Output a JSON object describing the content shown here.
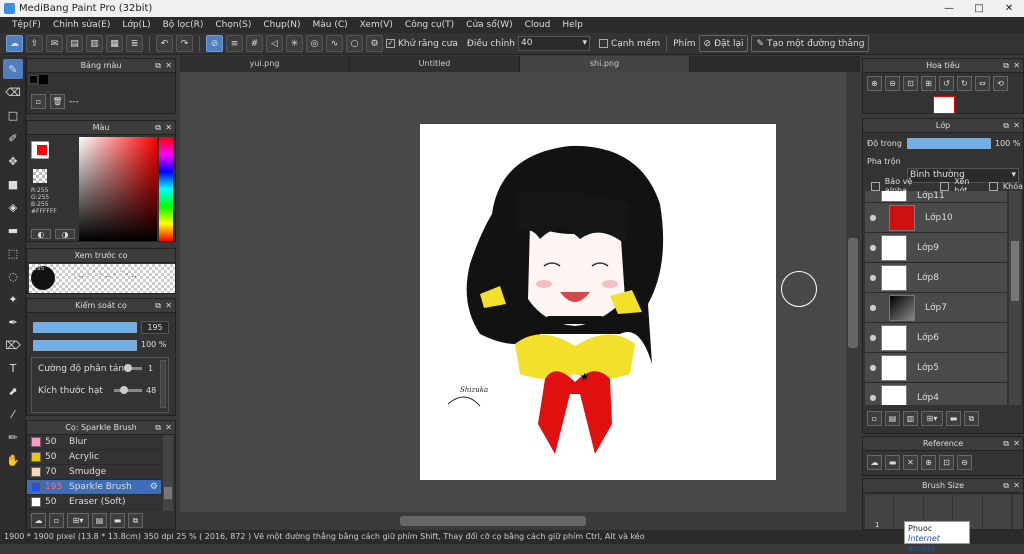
{
  "window": {
    "title": "MediBang Paint Pro (32bit)",
    "minimize": "—",
    "maximize": "□",
    "close": "✕"
  },
  "menu": [
    "Tệp(F)",
    "Chỉnh sửa(E)",
    "Lớp(L)",
    "Bộ lọc(R)",
    "Chọn(S)",
    "Chụp(N)",
    "Màu (C)",
    "Xem(V)",
    "Công cụ(T)",
    "Cửa sổ(W)",
    "Cloud",
    "Help"
  ],
  "toolbar": {
    "antialias_label": "Khử răng cưa",
    "adjust_label": "Điều chỉnh",
    "adjust_value": "40",
    "edge_label": "Cạnh mềm",
    "key_label": "Phím",
    "reset_label": "Đặt lại",
    "line_label": "Tạo một đường thẳng"
  },
  "colors": {
    "accent": "#4f7fc0",
    "primary": "#ff0000",
    "secondary": "#ffffff"
  },
  "palette_panel": {
    "title": "Bảng màu",
    "dash": "---"
  },
  "color_panel": {
    "title": "Màu",
    "r": "R:255",
    "g": "G:255",
    "b": "B:255",
    "hex": "#FFFFFF"
  },
  "brush_preview": {
    "title": "Xem trước cọ",
    "size": "195"
  },
  "brush_control": {
    "title": "Kiểm soát cọ",
    "size_value": "195",
    "opacity_value": "100 %",
    "scatter_label": "Cường độ phân tán",
    "scatter_value": "1",
    "particle_label": "Kích thước hạt",
    "particle_value": "48"
  },
  "brush_list": {
    "title": "Cọ: Sparkle Brush",
    "items": [
      {
        "size": "50",
        "name": "Blur",
        "color": "#ff99cc"
      },
      {
        "size": "50",
        "name": "Acrylic",
        "color": "#e8c800"
      },
      {
        "size": "70",
        "name": "Smudge",
        "color": "#f8d8b8"
      },
      {
        "size": "195",
        "name": "Sparkle Brush",
        "color": "#2255dd"
      },
      {
        "size": "50",
        "name": "Eraser (Soft)",
        "color": "#ffffff"
      }
    ]
  },
  "tabs": [
    "yui.png",
    "Untitled",
    "shi.png"
  ],
  "canvas": {
    "signature": "Shizuka"
  },
  "navigator": {
    "title": "Hoa tiêu"
  },
  "layer_panel": {
    "title": "Lớp",
    "opacity_label": "Độ trong",
    "opacity_value": "100 %",
    "blend_label": "Pha trộn",
    "blend_value": "Bình thường",
    "protect_alpha": "Bảo vệ alpha",
    "clipping": "Xén bớt",
    "lock": "Khóa",
    "layers": [
      {
        "name": "Lớp11"
      },
      {
        "name": "Lớp10"
      },
      {
        "name": "Lớp9"
      },
      {
        "name": "Lớp8"
      },
      {
        "name": "Lớp7"
      },
      {
        "name": "Lớp6"
      },
      {
        "name": "Lớp5"
      },
      {
        "name": "Lớp4"
      }
    ]
  },
  "reference_panel": {
    "title": "Reference"
  },
  "brush_size_panel": {
    "title": "Brush Size",
    "first_value": "1"
  },
  "status": "1900 * 1900 pixel   (13.8 * 13.8cm)   350 dpi   25 %   ( 2016, 872 )   Vẽ một đường thẳng bằng cách giữ phím Shift, Thay đổi cỡ cọ bằng cách giữ phím Ctrl, Alt và kéo",
  "tooltip": {
    "line1": "Phuoc",
    "line2": "Internet access"
  }
}
